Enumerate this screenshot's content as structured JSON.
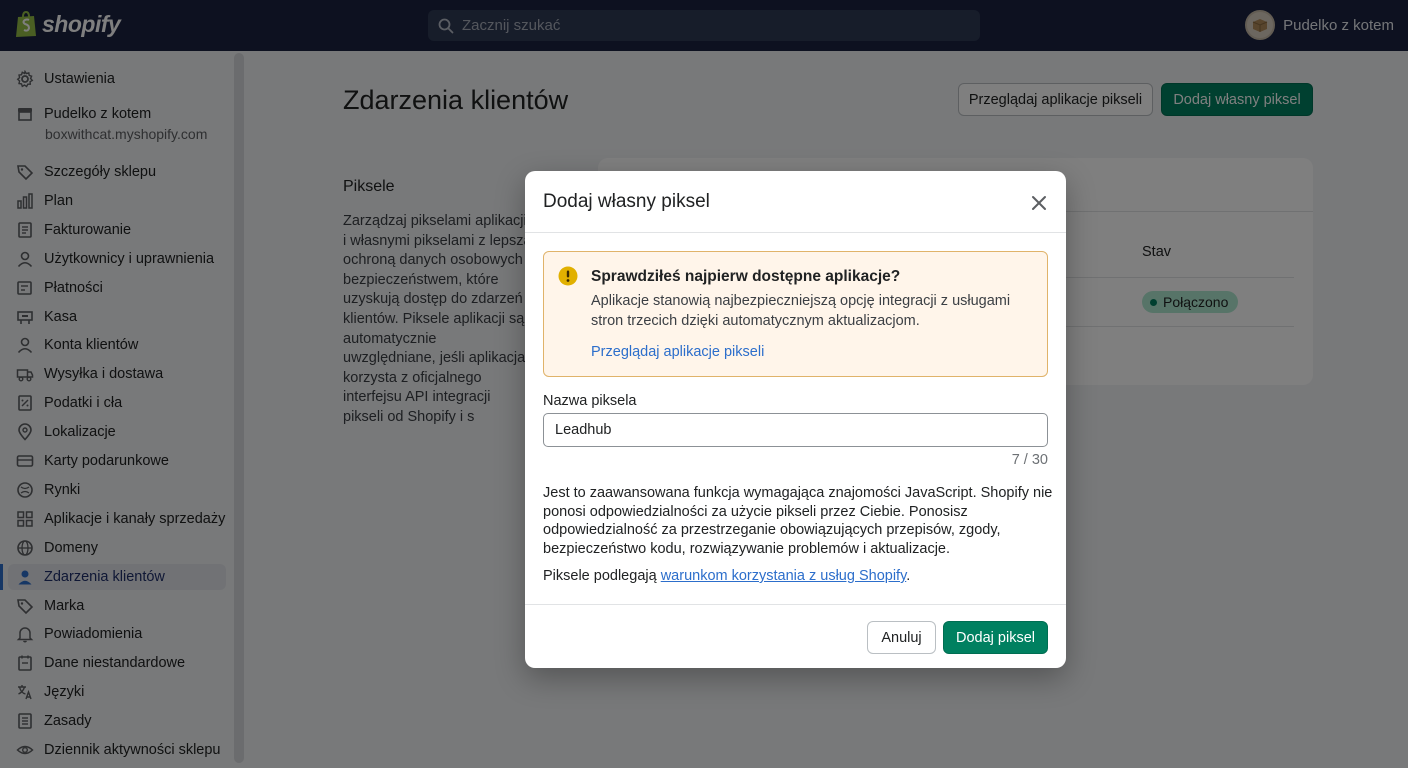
{
  "topbar": {
    "logo_text": "shopify",
    "search_placeholder": "Zacznij szukać",
    "account_name": "Pudelko z kotem"
  },
  "sidebar": {
    "settings_label": "Ustawienia",
    "store_name": "Pudelko z kotem",
    "store_domain": "boxwithcat.myshopify.com",
    "items": [
      {
        "label": "Szczegóły sklepu",
        "icon": "store-tag-icon"
      },
      {
        "label": "Plan",
        "icon": "plan-icon"
      },
      {
        "label": "Fakturowanie",
        "icon": "billing-icon"
      },
      {
        "label": "Użytkownicy i uprawnienia",
        "icon": "user-icon"
      },
      {
        "label": "Płatności",
        "icon": "payments-icon"
      },
      {
        "label": "Kasa",
        "icon": "checkout-icon"
      },
      {
        "label": "Konta klientów",
        "icon": "customer-accounts-icon"
      },
      {
        "label": "Wysyłka i dostawa",
        "icon": "truck-icon"
      },
      {
        "label": "Podatki i cła",
        "icon": "taxes-icon"
      },
      {
        "label": "Lokalizacje",
        "icon": "location-pin-icon"
      },
      {
        "label": "Karty podarunkowe",
        "icon": "gift-card-icon"
      },
      {
        "label": "Rynki",
        "icon": "markets-icon"
      },
      {
        "label": "Aplikacje i kanały sprzedaży",
        "icon": "apps-icon"
      },
      {
        "label": "Domeny",
        "icon": "globe-icon"
      },
      {
        "label": "Zdarzenia klientów",
        "icon": "customer-events-icon",
        "active": true
      },
      {
        "label": "Marka",
        "icon": "brand-tag-icon"
      },
      {
        "label": "Powiadomienia",
        "icon": "bell-icon"
      },
      {
        "label": "Dane niestandardowe",
        "icon": "custom-data-icon"
      },
      {
        "label": "Języki",
        "icon": "languages-icon"
      },
      {
        "label": "Zasady",
        "icon": "policies-icon"
      },
      {
        "label": "Dziennik aktywności sklepu",
        "icon": "eye-icon"
      }
    ]
  },
  "main": {
    "title": "Zdarzenia klientów",
    "browse_button": "Przeglądaj aplikacje pikseli",
    "add_button": "Dodaj własny piksel",
    "section_title": "Piksele",
    "section_desc": "Zarządzaj pikselami aplikacji i własnymi pikselami z lepszą ochroną danych osobowych i bezpieczeństwem, które uzyskują dostęp do zdarzeń klientów. Piksele aplikacji są automatycznie uwzględniane, jeśli aplikacja korzysta z oficjalnego interfejsu API integracji pikseli od Shopify i s",
    "table_status_header": "Stav",
    "status_value": "Połączono"
  },
  "modal": {
    "title": "Dodaj własny piksel",
    "banner_title": "Sprawdziłeś najpierw dostępne aplikacje?",
    "banner_text": "Aplikacje stanowią najbezpieczniejszą opcję integracji z usługami stron trzecich dzięki automatycznym aktualizacjom.",
    "banner_link": "Przeglądaj aplikacje pikseli",
    "field_label": "Nazwa piksela",
    "field_value": "Leadhub",
    "char_count": "7 / 30",
    "disclaimer": "Jest to zaawansowana funkcja wymagająca znajomości JavaScript. Shopify nie ponosi odpowiedzialności za użycie pikseli przez Ciebie. Ponosisz odpowiedzialność za przestrzeganie obowiązujących przepisów, zgody, bezpieczeństwo kodu, rozwiązywanie problemów i aktualizacje.",
    "terms_prefix": "Piksele podlegają ",
    "terms_link": "warunkom korzystania z usług Shopify",
    "terms_suffix": ".",
    "cancel_button": "Anuluj",
    "confirm_button": "Dodaj piksel"
  },
  "colors": {
    "topbar": "#1a2340",
    "primary": "#008060",
    "link": "#2c6ecb",
    "warning_bg": "#fff5ea",
    "warning_border": "#e0b36a",
    "warning_icon": "#b98900"
  }
}
